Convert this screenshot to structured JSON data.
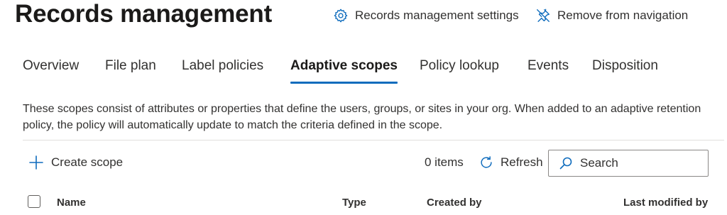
{
  "header": {
    "title": "Records management",
    "settings_label": "Records management settings",
    "remove_nav_label": "Remove from navigation"
  },
  "tabs": [
    {
      "label": "Overview"
    },
    {
      "label": "File plan"
    },
    {
      "label": "Label policies"
    },
    {
      "label": "Adaptive scopes",
      "active": true
    },
    {
      "label": "Policy lookup"
    },
    {
      "label": "Events"
    },
    {
      "label": "Disposition"
    }
  ],
  "description": "These scopes consist of attributes or properties that define the users, groups, or sites in your org. When added to an adaptive retention policy, the policy will automatically update to match the criteria defined in the scope.",
  "toolbar": {
    "create_label": "Create scope",
    "item_count": "0 items",
    "refresh_label": "Refresh",
    "search_placeholder": "Search"
  },
  "table": {
    "columns": [
      "Name",
      "Type",
      "Created by",
      "Last modified by"
    ]
  },
  "colors": {
    "accent": "#0f6cbd",
    "text": "#323130",
    "divider": "#e1dfdd"
  },
  "icons": {
    "settings": "gear-icon",
    "remove_nav": "unpin-icon",
    "create": "plus-icon",
    "refresh": "refresh-icon",
    "search": "search-icon"
  }
}
